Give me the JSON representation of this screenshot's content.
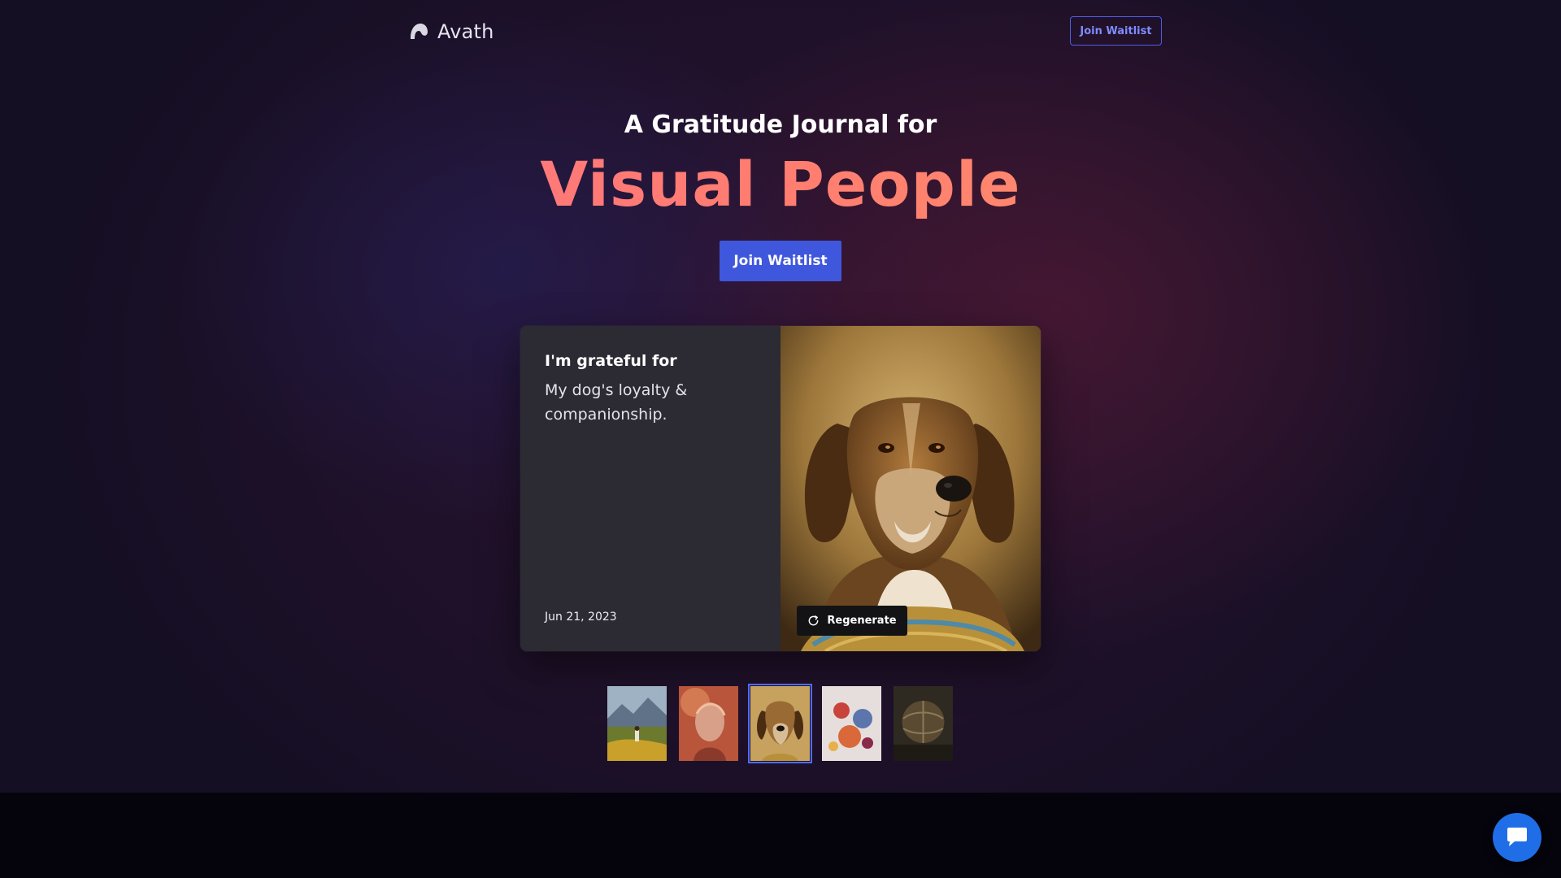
{
  "nav": {
    "brand": "Avath",
    "logo_icon": "avath-logo-icon",
    "cta_label": "Join Waitlist"
  },
  "hero": {
    "subheadline": "A Gratitude Journal for",
    "headline": "Visual People",
    "cta_label": "Join Waitlist"
  },
  "card": {
    "heading": "I'm grateful for",
    "text": "My dog's loyalty & companionship.",
    "date": "Jun 21, 2023",
    "regenerate_label": "Regenerate",
    "regenerate_icon": "refresh-icon",
    "image_icon": "dog-portrait-image"
  },
  "thumbnails": [
    {
      "name": "landscape-thumbnail",
      "selected": false
    },
    {
      "name": "portrait-thumbnail",
      "selected": false
    },
    {
      "name": "dog-thumbnail",
      "selected": true
    },
    {
      "name": "abstract-thumbnail",
      "selected": false
    },
    {
      "name": "globe-thumbnail",
      "selected": false
    }
  ],
  "chat": {
    "icon": "chat-bubble-icon"
  },
  "colors": {
    "accent": "#3f57dc",
    "headline_gradient_start": "#ff6f8a",
    "headline_gradient_end": "#ff9a6a",
    "card_panel": "#2c2a33",
    "chat_button": "#1f6ee8"
  }
}
